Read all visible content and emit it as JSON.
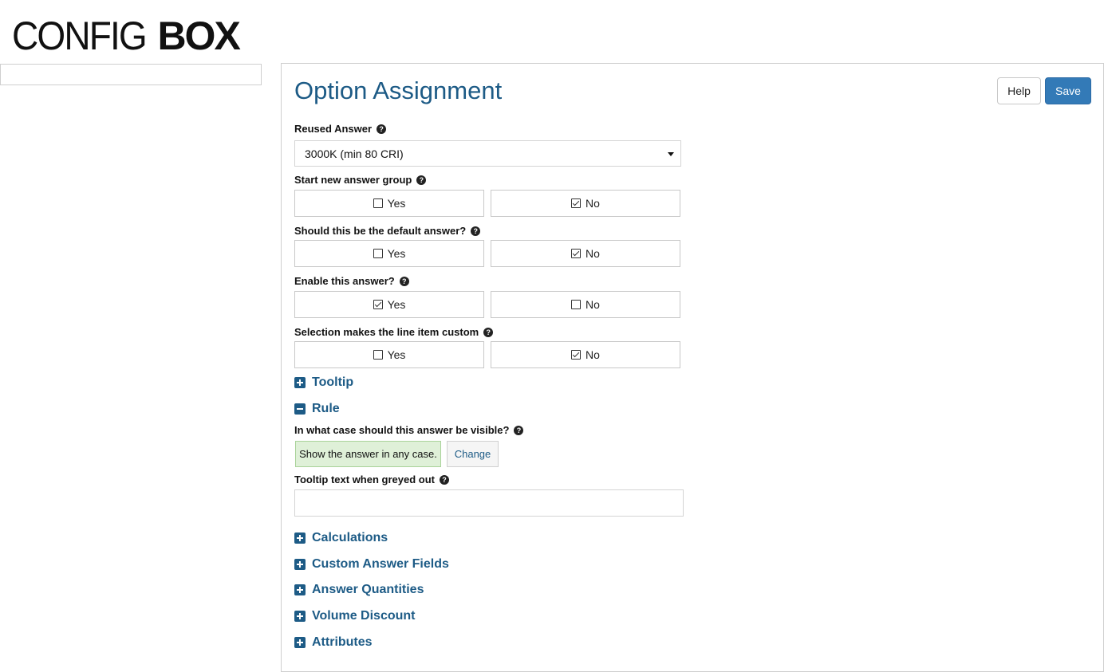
{
  "brand": {
    "logo_light": "CONFIG",
    "logo_bold": "BOX"
  },
  "page": {
    "title": "Option Assignment",
    "help_label": "Help",
    "save_label": "Save"
  },
  "reused_answer": {
    "label": "Reused Answer",
    "value": "3000K (min 80 CRI)"
  },
  "toggles": [
    {
      "label": "Start new answer group",
      "yes_label": "Yes",
      "no_label": "No",
      "selected": "No"
    },
    {
      "label": "Should this be the default answer?",
      "yes_label": "Yes",
      "no_label": "No",
      "selected": "No"
    },
    {
      "label": "Enable this answer?",
      "yes_label": "Yes",
      "no_label": "No",
      "selected": "Yes"
    },
    {
      "label": "Selection makes the line item custom",
      "yes_label": "Yes",
      "no_label": "No",
      "selected": "No"
    }
  ],
  "sections": {
    "tooltip": {
      "label": "Tooltip",
      "state": "collapsed"
    },
    "rule": {
      "label": "Rule",
      "state": "expanded"
    },
    "calculations": {
      "label": "Calculations",
      "state": "collapsed"
    },
    "custom_answer_fields": {
      "label": "Custom Answer Fields",
      "state": "collapsed"
    },
    "answer_quantities": {
      "label": "Answer Quantities",
      "state": "collapsed"
    },
    "volume_discount": {
      "label": "Volume Discount",
      "state": "collapsed"
    },
    "attributes": {
      "label": "Attributes",
      "state": "collapsed"
    }
  },
  "rule": {
    "visibility_label": "In what case should this answer be visible?",
    "rule_text": "Show the answer in any case.",
    "change_label": "Change",
    "greyed_tooltip_label": "Tooltip text when greyed out",
    "greyed_tooltip_value": ""
  },
  "colors": {
    "accent": "#1d5b86",
    "primary_button": "#337ab7",
    "rule_bg": "#dff0d8"
  },
  "icons": {
    "help": "question-circle-icon",
    "expand": "plus-square-icon",
    "collapse": "minus-square-icon",
    "dropdown": "caret-down-icon"
  }
}
